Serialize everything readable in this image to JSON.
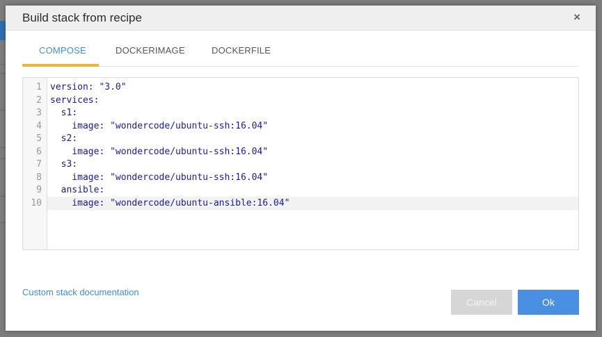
{
  "dialog": {
    "title": "Build stack from recipe",
    "close_label": "×"
  },
  "tabs": [
    {
      "label": "COMPOSE",
      "active": true
    },
    {
      "label": "DOCKERIMAGE",
      "active": false
    },
    {
      "label": "DOCKERFILE",
      "active": false
    }
  ],
  "editor": {
    "line_numbers": [
      "1",
      "2",
      "3",
      "4",
      "5",
      "6",
      "7",
      "8",
      "9",
      "10"
    ],
    "lines": [
      {
        "key": "version",
        "sep": ": ",
        "value": "\"3.0\""
      },
      {
        "key": "services",
        "sep": ":",
        "value": ""
      },
      {
        "key": "  s1",
        "sep": ":",
        "value": ""
      },
      {
        "key": "    image",
        "sep": ": ",
        "value": "\"wondercode/ubuntu-ssh:16.04\""
      },
      {
        "key": "  s2",
        "sep": ":",
        "value": ""
      },
      {
        "key": "    image",
        "sep": ": ",
        "value": "\"wondercode/ubuntu-ssh:16.04\""
      },
      {
        "key": "  s3",
        "sep": ":",
        "value": ""
      },
      {
        "key": "    image",
        "sep": ": ",
        "value": "\"wondercode/ubuntu-ssh:16.04\""
      },
      {
        "key": "  ansible",
        "sep": ":",
        "value": ""
      },
      {
        "key": "    image",
        "sep": ": ",
        "value": "\"wondercode/ubuntu-ansible:16.04\""
      }
    ]
  },
  "footer": {
    "doc_link": "Custom stack documentation",
    "cancel_label": "Cancel",
    "ok_label": "Ok"
  },
  "colors": {
    "accent": "#4a90e2",
    "tab_active_underline": "#f0b23b",
    "link": "#3a8fd0"
  }
}
